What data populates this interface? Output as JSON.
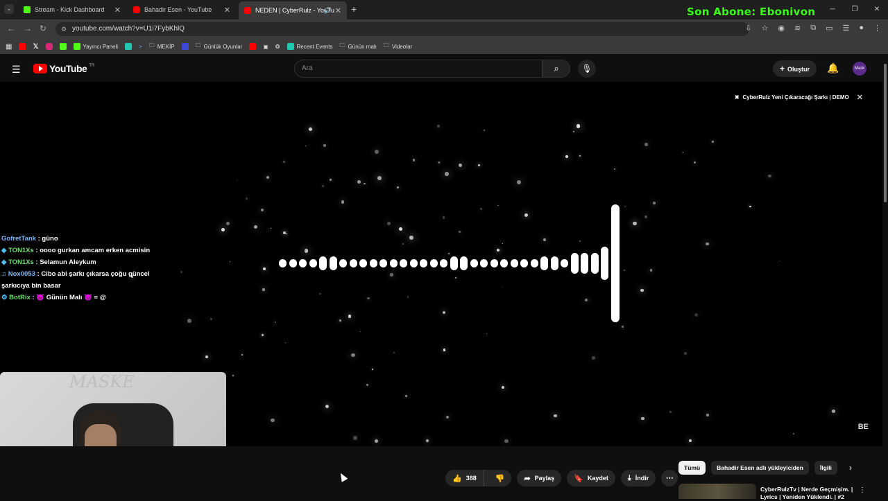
{
  "browser": {
    "tabs": [
      {
        "label": "Stream - Kick Dashboard",
        "favicon_color": "#53fc18"
      },
      {
        "label": "Bahadir Esen - YouTube",
        "favicon_color": "#ff0000"
      },
      {
        "label": "NEDEN | CyberRulz - YouTu",
        "favicon_color": "#ff0000"
      }
    ],
    "url": "youtube.com/watch?v=U1i7FybKhlQ",
    "bookmarks": [
      "Yayıncı Paneli",
      "MEKİP",
      "Günlük Oyunlar",
      "Recent Events",
      "Günün malı",
      "Videolar"
    ]
  },
  "overlay": {
    "subscriber_banner": "Son Abone: Ebonivon"
  },
  "youtube": {
    "logo_text": "YouTube",
    "region": "TR",
    "search_placeholder": "Ara",
    "create_label": "Oluştur",
    "avatar_text": "Mask"
  },
  "video": {
    "overlay_title": "CyberRulz Yeni Çıkaracağı Şarkı | DEMO",
    "brand_mark": "BE",
    "visualizer_levels": [
      0.04,
      0.06,
      0.06,
      0.06,
      0.12,
      0.12,
      0.06,
      0.06,
      0.06,
      0.06,
      0.06,
      0.06,
      0.06,
      0.06,
      0.06,
      0.06,
      0.06,
      0.12,
      0.12,
      0.06,
      0.06,
      0.06,
      0.06,
      0.06,
      0.06,
      0.06,
      0.12,
      0.12,
      0.06,
      0.18,
      0.18,
      0.18,
      0.28,
      1.0
    ]
  },
  "chat": [
    {
      "user": "GofretTank",
      "message": "güno",
      "badge": ""
    },
    {
      "user": "TON1Xs",
      "message": "oooo gurkan amcam erken acmisin",
      "badge": "◆"
    },
    {
      "user": "TON1Xs",
      "message": "Selamun Aleykum",
      "badge": "◆"
    },
    {
      "user": "Nox0053",
      "message": "Cibo abi şarkı çıkarsa çoğu güncel şarkıcıya bin basar",
      "badge": "♫"
    },
    {
      "user": "BotRix",
      "message": "😈 Gü̈nün Malı 😈 = @",
      "badge": "⚙"
    }
  ],
  "webcam": {
    "wall_text": "MASKE"
  },
  "actions": {
    "like_count": "388",
    "share": "Paylaş",
    "save": "Kaydet",
    "download": "İndir"
  },
  "filters": [
    "Tümü",
    "Bahadir Esen adlı yükleyiciden",
    "İlgili"
  ],
  "recommendation": {
    "title": "CyberRulzTv | Nerde Geçmişim. | Lyrics | Yeniden Yüklendi. | #2"
  }
}
